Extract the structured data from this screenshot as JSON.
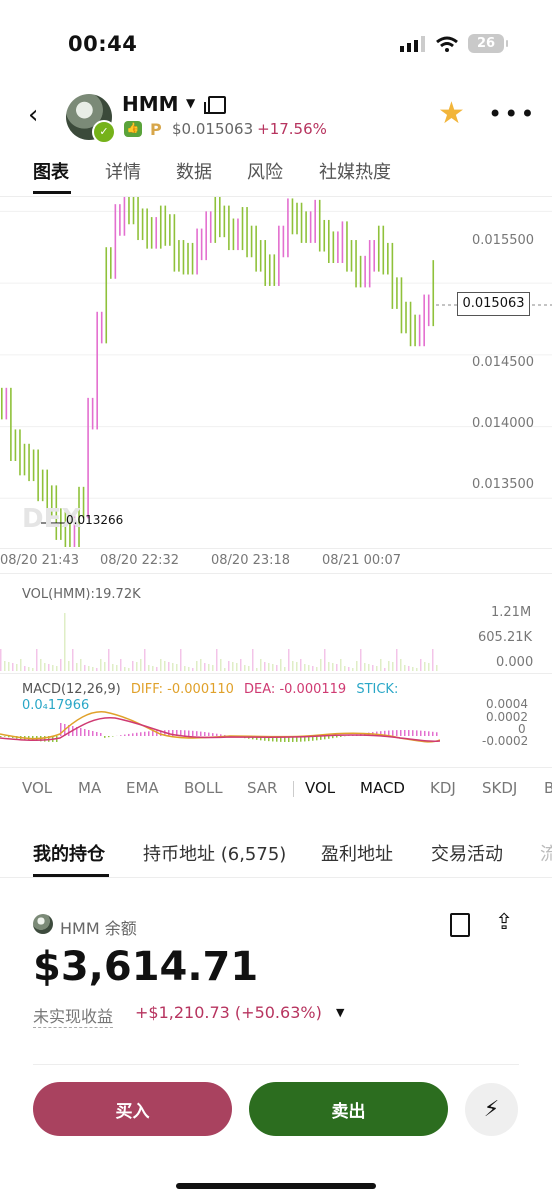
{
  "status_bar": {
    "time": "00:44",
    "battery": "26"
  },
  "header": {
    "name": "HMM",
    "price": "$0.015063",
    "change": "+17.56%"
  },
  "tabs": [
    {
      "label": "图表",
      "active": true
    },
    {
      "label": "详情",
      "active": false
    },
    {
      "label": "数据",
      "active": false
    },
    {
      "label": "风险",
      "active": false
    },
    {
      "label": "社媒热度",
      "active": false
    }
  ],
  "chart": {
    "price_ticks": [
      "0.015500",
      "0.015000",
      "0.014500",
      "0.014000",
      "0.013500"
    ],
    "current_price_label": "0.015063",
    "low_label": "0.013266",
    "watermark": "DEX",
    "time_labels": [
      "08/20 21:43",
      "08/20 22:32",
      "08/20 23:18",
      "08/21 00:07"
    ],
    "up_color": "#e36fcf",
    "down_color": "#8fc13a"
  },
  "volume": {
    "title": "VOL(HMM):19.72K",
    "ticks": [
      "1.21M",
      "605.21K",
      "0.000"
    ]
  },
  "macd": {
    "title": "MACD(12,26,9)",
    "diff": "DIFF: -0.000110",
    "dea": "DEA: -0.000119",
    "stick": "STICK:",
    "stick_value": "0.0₄17966",
    "ticks": [
      "0.0004",
      "0.0002",
      "0",
      "-0.0002"
    ]
  },
  "indicators": [
    "VOL",
    "MA",
    "EMA",
    "BOLL",
    "SAR",
    "VOL",
    "MACD",
    "KDJ",
    "SKDJ",
    "B"
  ],
  "section_tabs": [
    "我的持仓",
    "持币地址 (6,575)",
    "盈利地址",
    "交易活动",
    "流"
  ],
  "holding": {
    "label": "HMM 余额",
    "balance": "$3,614.71",
    "pnl_label": "未实现收益",
    "pnl_value": "+$1,210.73 (+50.63%)"
  },
  "actions": {
    "buy": "买入",
    "sell": "卖出"
  },
  "chart_data": {
    "type": "line",
    "x_labels": [
      "08/20 21:43",
      "08/20 22:32",
      "08/20 23:18",
      "08/21 00:07"
    ],
    "ylim": [
      0.0133,
      0.0156
    ],
    "series": [
      {
        "values": [
          0.01417,
          0.01388,
          0.01378,
          0.01374,
          0.0136,
          0.01349,
          0.01333,
          0.01328,
          0.01348,
          0.0141,
          0.0147,
          0.01515,
          0.01545,
          0.0156,
          0.01553,
          0.01542,
          0.01536,
          0.01544,
          0.01538,
          0.0152,
          0.01518,
          0.01528,
          0.0154,
          0.01552,
          0.01544,
          0.01535,
          0.01543,
          0.0153,
          0.0152,
          0.0151,
          0.0153,
          0.01549,
          0.01546,
          0.0154,
          0.01548,
          0.01534,
          0.01526,
          0.01533,
          0.0152,
          0.01509,
          0.0152,
          0.0153,
          0.01518,
          0.01494,
          0.01477,
          0.01468,
          0.01482,
          0.01506
        ]
      }
    ]
  }
}
